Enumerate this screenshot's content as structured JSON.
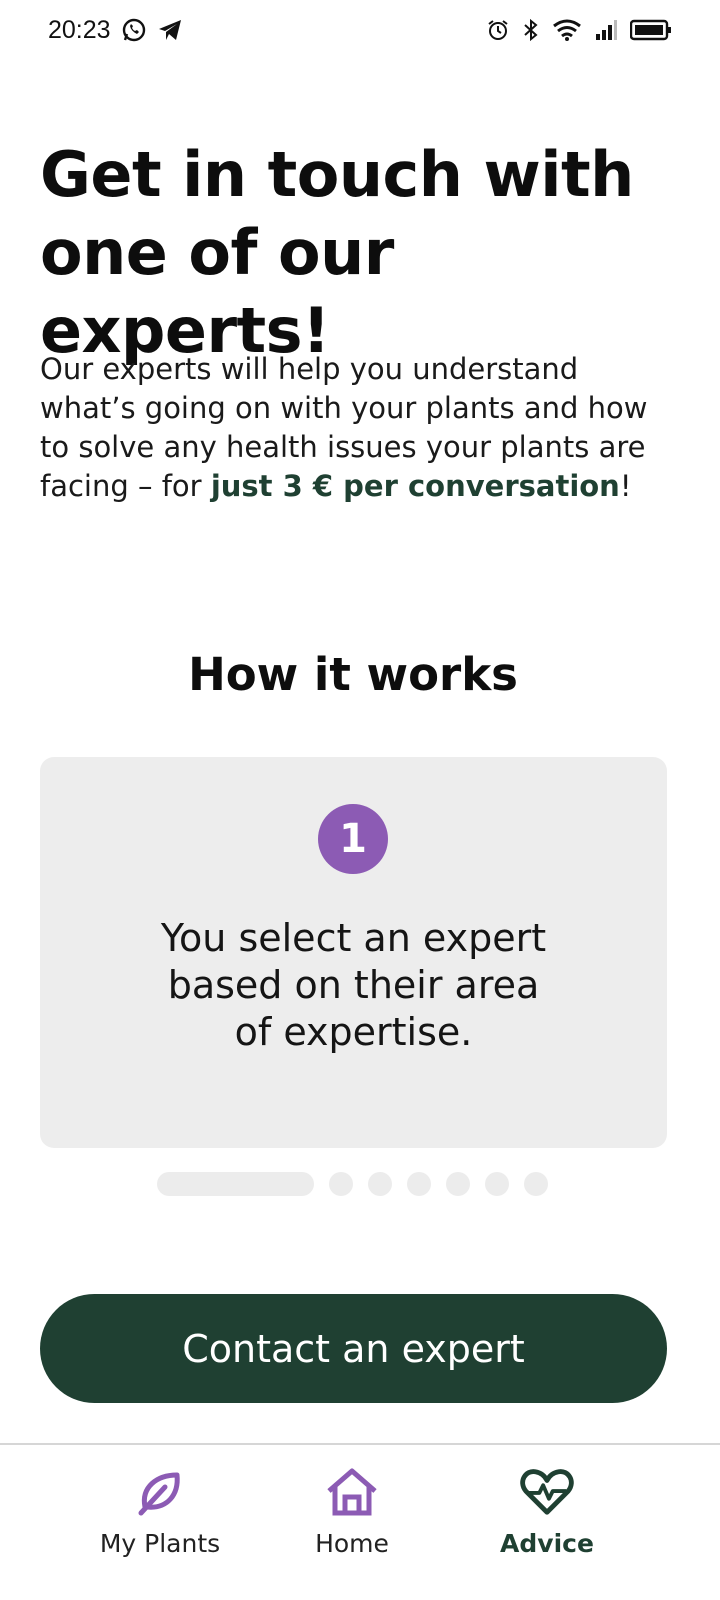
{
  "status_bar": {
    "time": "20:23",
    "left_icons": [
      "whatsapp-icon",
      "telegram-icon"
    ],
    "right_icons": [
      "alarm-icon",
      "bluetooth-icon",
      "wifi-icon",
      "signal-icon",
      "battery-icon"
    ]
  },
  "header": {
    "title": "Get in touch with one of our experts!"
  },
  "intro": {
    "text_before": "Our experts will help you understand what’s going on with your plants and how to solve any health issues your plants are facing – for ",
    "highlight": "just 3 € per conversation",
    "text_after": "!"
  },
  "how_it_works": {
    "title": "How it works",
    "current_step": {
      "number": "1",
      "text": "You select an expert based on their area of expertise."
    },
    "pager": {
      "total": 7,
      "active_index": 0
    }
  },
  "cta": {
    "label": "Contact an expert"
  },
  "bottom_nav": {
    "items": [
      {
        "label": "My Plants",
        "icon": "leaf-icon",
        "active": false
      },
      {
        "label": "Home",
        "icon": "home-icon",
        "active": false
      },
      {
        "label": "Advice",
        "icon": "heart-pulse-icon",
        "active": true
      }
    ]
  },
  "colors": {
    "brand_dark_green": "#1f4032",
    "accent_purple": "#8c5bb4",
    "card_grey": "#ededed"
  }
}
